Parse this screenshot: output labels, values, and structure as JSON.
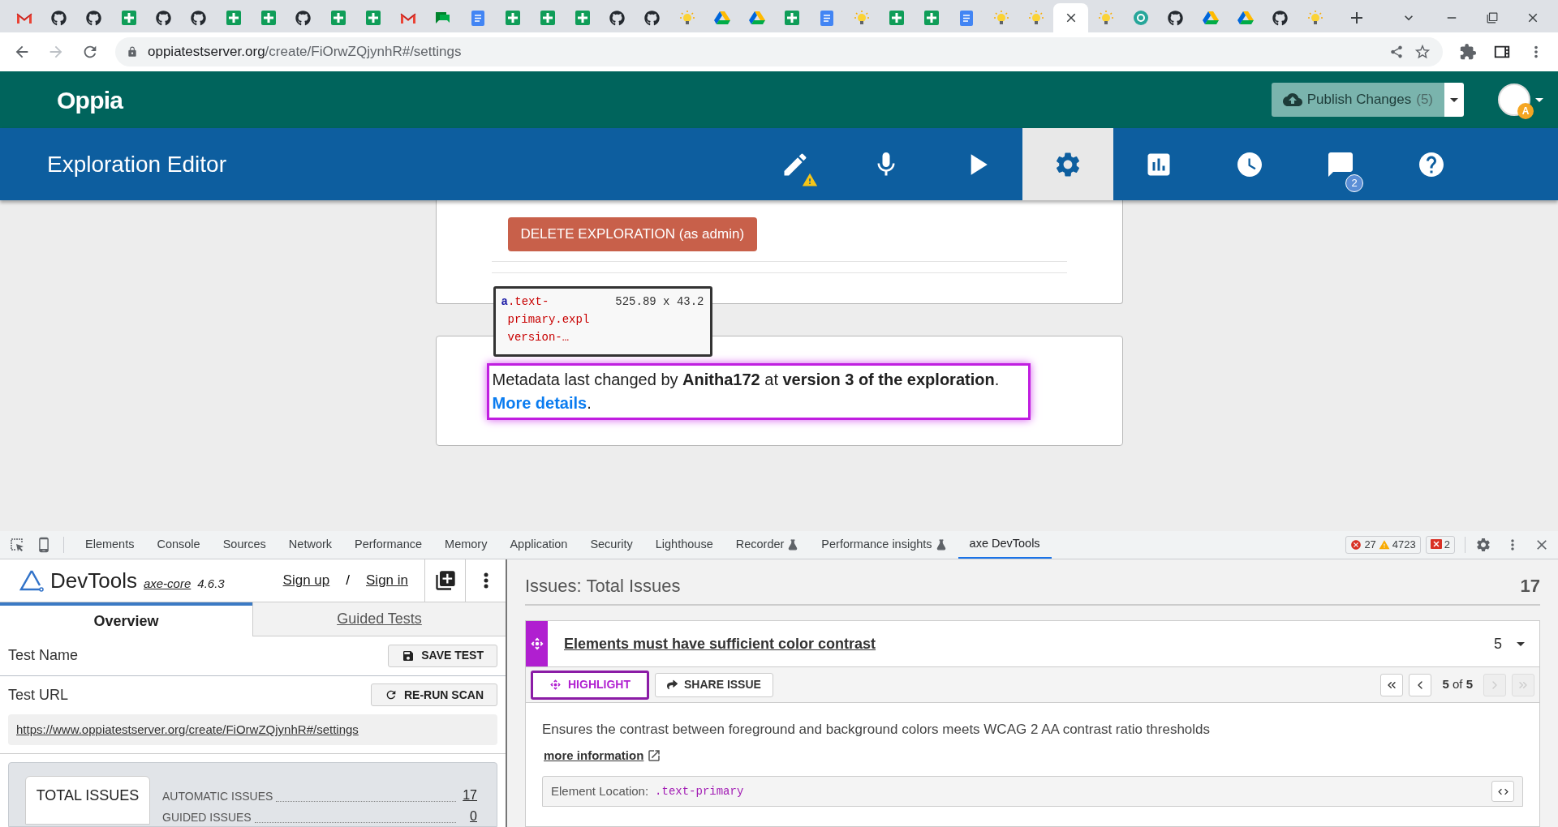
{
  "browser": {
    "tabs": [
      {
        "kind": "gmail",
        "selected": false
      },
      {
        "kind": "github",
        "selected": false
      },
      {
        "kind": "github",
        "selected": false
      },
      {
        "kind": "sheets",
        "selected": false
      },
      {
        "kind": "github",
        "selected": false
      },
      {
        "kind": "github",
        "selected": false
      },
      {
        "kind": "sheets",
        "selected": false
      },
      {
        "kind": "sheets",
        "selected": false
      },
      {
        "kind": "github",
        "selected": false
      },
      {
        "kind": "sheets",
        "selected": false
      },
      {
        "kind": "sheets",
        "selected": false
      },
      {
        "kind": "gmail",
        "selected": false
      },
      {
        "kind": "chat",
        "selected": false
      },
      {
        "kind": "docs",
        "selected": false
      },
      {
        "kind": "sheets",
        "selected": false
      },
      {
        "kind": "sheets",
        "selected": false
      },
      {
        "kind": "sheets",
        "selected": false
      },
      {
        "kind": "github",
        "selected": false
      },
      {
        "kind": "github",
        "selected": false
      },
      {
        "kind": "bulb",
        "selected": false
      },
      {
        "kind": "drive",
        "selected": false
      },
      {
        "kind": "drive",
        "selected": false
      },
      {
        "kind": "sheets",
        "selected": false
      },
      {
        "kind": "docs",
        "selected": false
      },
      {
        "kind": "bulb",
        "selected": false
      },
      {
        "kind": "sheets",
        "selected": false
      },
      {
        "kind": "sheets",
        "selected": false
      },
      {
        "kind": "docs",
        "selected": false
      },
      {
        "kind": "bulb",
        "selected": false
      },
      {
        "kind": "bulb",
        "selected": false
      },
      {
        "selected": true
      },
      {
        "kind": "bulb",
        "selected": false
      },
      {
        "kind": "oppia",
        "selected": false
      },
      {
        "kind": "github",
        "selected": false
      },
      {
        "kind": "drive",
        "selected": false
      },
      {
        "kind": "drive",
        "selected": false
      },
      {
        "kind": "github",
        "selected": false
      },
      {
        "kind": "bulb",
        "selected": false
      }
    ],
    "url": {
      "host": "oppiatestserver.org",
      "path": "/create/FiOrwZQjynhR#/settings"
    }
  },
  "site_header": {
    "logo": "Oppia",
    "publish": {
      "label": "Publish Changes",
      "count": "(5)"
    },
    "avatar_badge": "A"
  },
  "editor_nav": {
    "title": "Exploration Editor",
    "items": [
      {
        "kind": "edit",
        "selected": false,
        "warning": true
      },
      {
        "kind": "mic",
        "selected": false,
        "warning": false
      },
      {
        "kind": "play",
        "selected": false,
        "warning": false
      },
      {
        "kind": "settings",
        "selected": true,
        "warning": false
      },
      {
        "kind": "stats",
        "selected": false,
        "warning": false
      },
      {
        "kind": "history",
        "selected": false,
        "warning": false
      },
      {
        "kind": "feedback",
        "selected": false,
        "warning": false,
        "badge": "2"
      },
      {
        "kind": "help",
        "selected": false,
        "warning": false
      }
    ]
  },
  "settings": {
    "delete_button": "DELETE EXPLORATION (as admin)",
    "metadata": {
      "text": "Metadata last changed by **Anitha172** at **version 3 of the exploration**.",
      "link": "More details",
      "end": "."
    },
    "inspect_tooltip": {
      "tag": "a",
      "selector_lines": [
        ".text-",
        "primary.expl",
        "version-…"
      ],
      "size": "525.89 x 43.2"
    }
  },
  "devtools": {
    "tabs": [
      {
        "label": "Elements",
        "experimental": false,
        "selected": false
      },
      {
        "label": "Console",
        "experimental": false,
        "selected": false
      },
      {
        "label": "Sources",
        "experimental": false,
        "selected": false
      },
      {
        "label": "Network",
        "experimental": false,
        "selected": false
      },
      {
        "label": "Performance",
        "experimental": false,
        "selected": false
      },
      {
        "label": "Memory",
        "experimental": false,
        "selected": false
      },
      {
        "label": "Application",
        "experimental": false,
        "selected": false
      },
      {
        "label": "Security",
        "experimental": false,
        "selected": false
      },
      {
        "label": "Lighthouse",
        "experimental": false,
        "selected": false
      },
      {
        "label": "Recorder",
        "experimental": true,
        "selected": false
      },
      {
        "label": "Performance insights",
        "experimental": true,
        "selected": false
      },
      {
        "label": "axe DevTools",
        "experimental": false,
        "selected": true
      }
    ],
    "counters": {
      "errors": "27",
      "warnings": "4723",
      "issues": "2"
    },
    "axe": {
      "brand": "DevTools",
      "core_link": "axe-core",
      "version": "4.6.3",
      "sign_up": "Sign up",
      "separator": "/",
      "sign_in": "Sign in",
      "tabs": [
        {
          "label": "Overview",
          "selected": true
        },
        {
          "label": "Guided Tests",
          "selected": false
        }
      ],
      "test_name_label": "Test Name",
      "save_button": "SAVE TEST",
      "test_url_label": "Test URL",
      "rerun_button": "RE-RUN SCAN",
      "test_url": "https://www.oppiatestserver.org/create/FiOrwZQjynhR#/settings",
      "summary": {
        "tab": "TOTAL ISSUES",
        "rows": [
          {
            "label": "AUTOMATIC ISSUES",
            "value": "17"
          },
          {
            "label": "GUIDED ISSUES",
            "value": "0"
          }
        ]
      }
    },
    "issues": {
      "title": "Issues: Total Issues",
      "total": "17",
      "issue": {
        "title": "Elements must have sufficient color contrast",
        "count": "5",
        "highlight_button": "HIGHLIGHT",
        "highlight_active": true,
        "share_button": "SHARE ISSUE",
        "pager": {
          "current": "5",
          "of": "of",
          "total": "5",
          "buttons": [
            {
              "kind": "first",
              "disabled": false
            },
            {
              "kind": "prev",
              "disabled": false
            },
            {
              "kind": "next",
              "disabled": true
            },
            {
              "kind": "last",
              "disabled": true
            }
          ]
        },
        "description": "Ensures the contrast between foreground and background colors meets WCAG 2 AA contrast ratio thresholds",
        "more_info": "more information",
        "location_label": "Element Location:",
        "location": ".text-primary"
      }
    }
  }
}
